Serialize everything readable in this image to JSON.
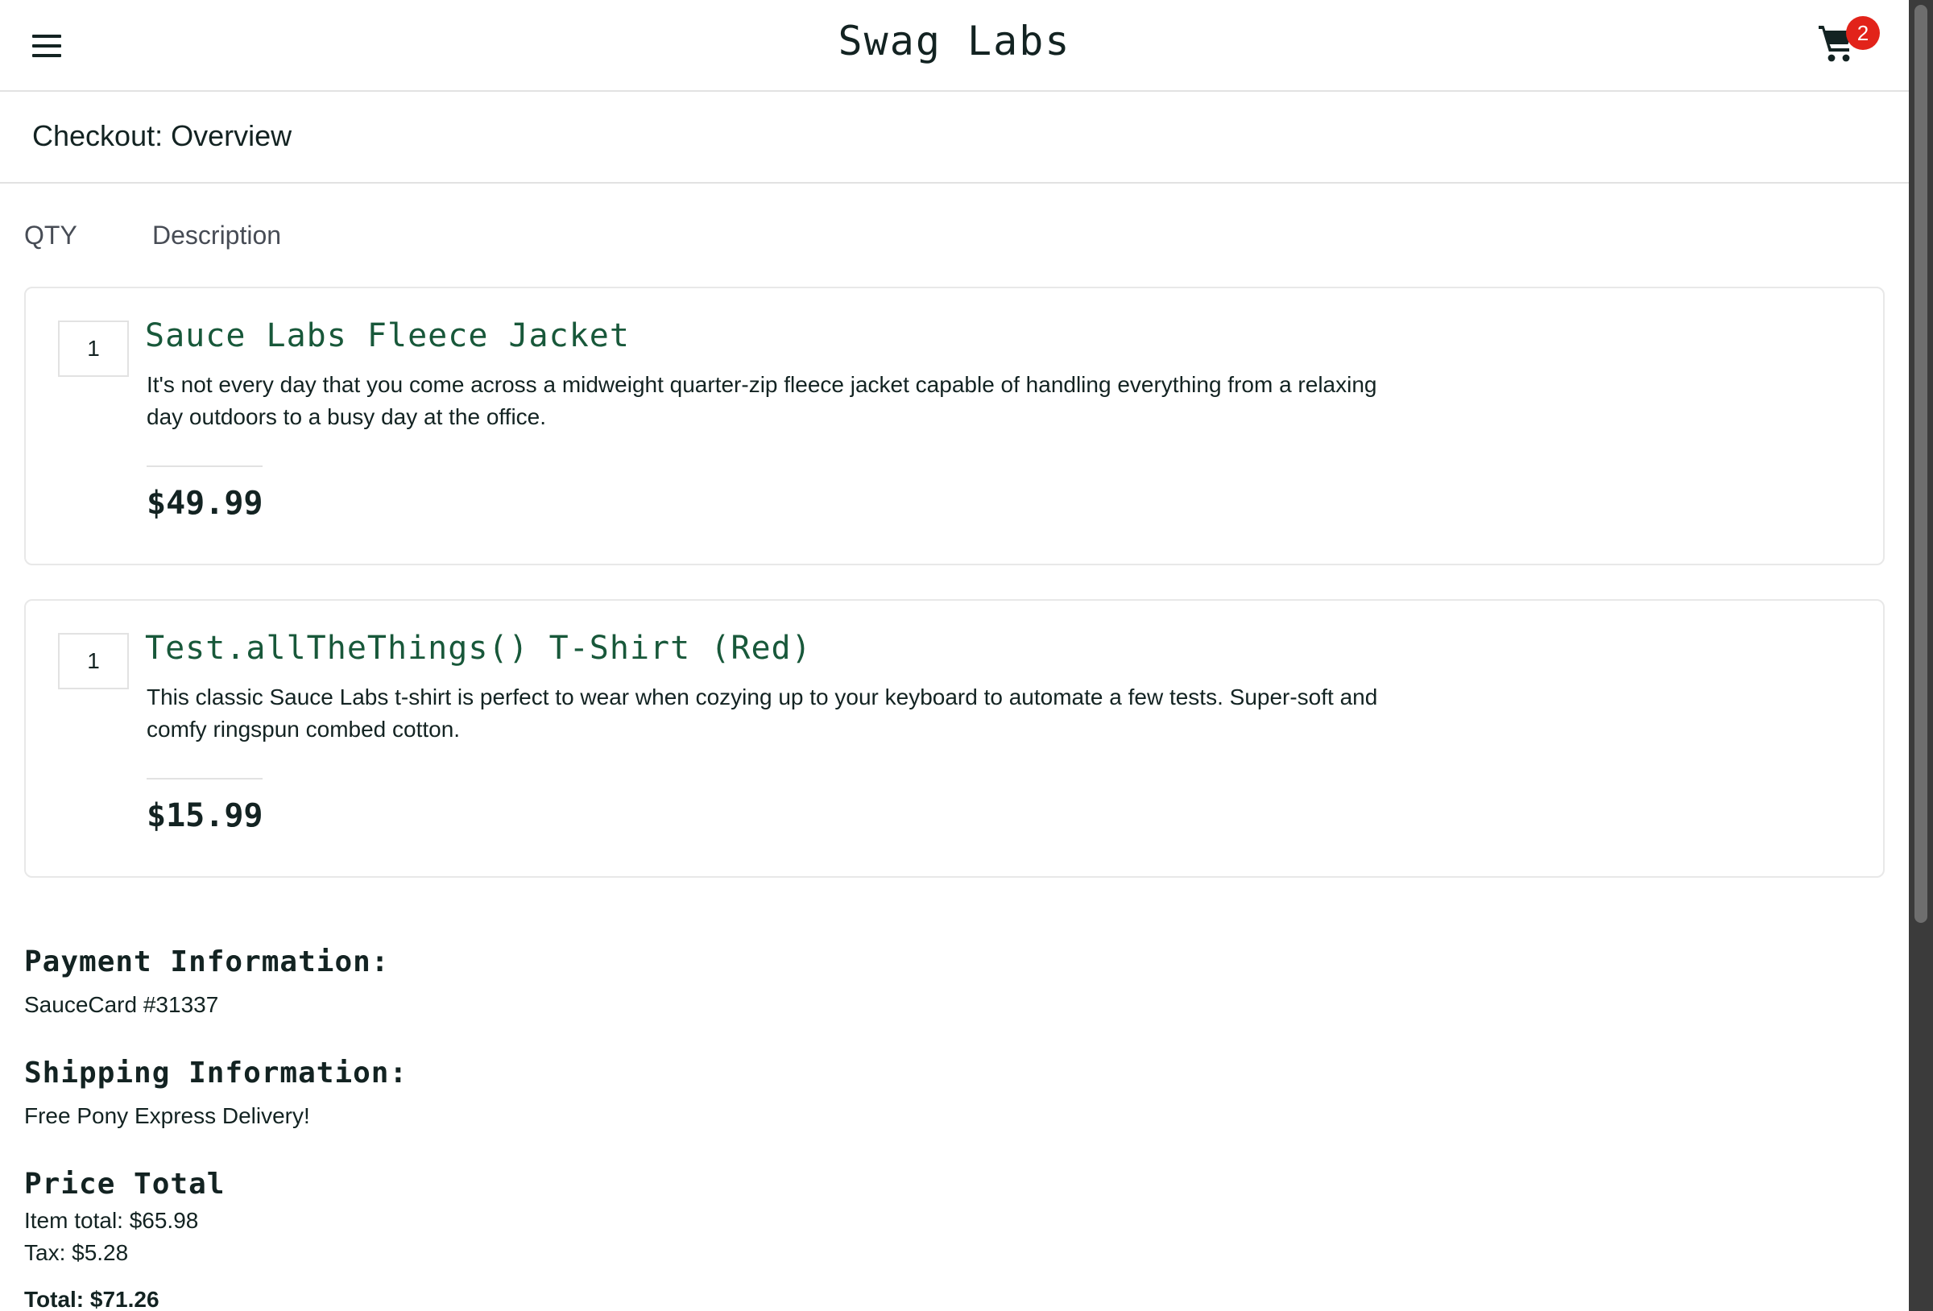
{
  "header": {
    "app_title": "Swag Labs",
    "cart_count": "2"
  },
  "page": {
    "title": "Checkout: Overview",
    "qty_label": "QTY",
    "description_label": "Description"
  },
  "items": [
    {
      "qty": "1",
      "name": "Sauce Labs Fleece Jacket",
      "description": "It's not every day that you come across a midweight quarter-zip fleece jacket capable of handling everything from a relaxing day outdoors to a busy day at the office.",
      "price": "$49.99"
    },
    {
      "qty": "1",
      "name": "Test.allTheThings() T-Shirt (Red)",
      "description": "This classic Sauce Labs t-shirt is perfect to wear when cozying up to your keyboard to automate a few tests. Super-soft and comfy ringspun combed cotton.",
      "price": "$15.99"
    }
  ],
  "summary": {
    "payment_heading": "Payment Information:",
    "payment_value": "SauceCard #31337",
    "shipping_heading": "Shipping Information:",
    "shipping_value": "Free Pony Express Delivery!",
    "price_heading": "Price Total",
    "item_total": "Item total: $65.98",
    "tax": "Tax: $5.28",
    "total": "Total: $71.26"
  },
  "colors": {
    "accent_green": "#18583a",
    "badge_red": "#e2231a",
    "text_dark": "#132322"
  },
  "icons": {
    "menu": "menu-icon",
    "cart": "shopping-cart-icon"
  }
}
